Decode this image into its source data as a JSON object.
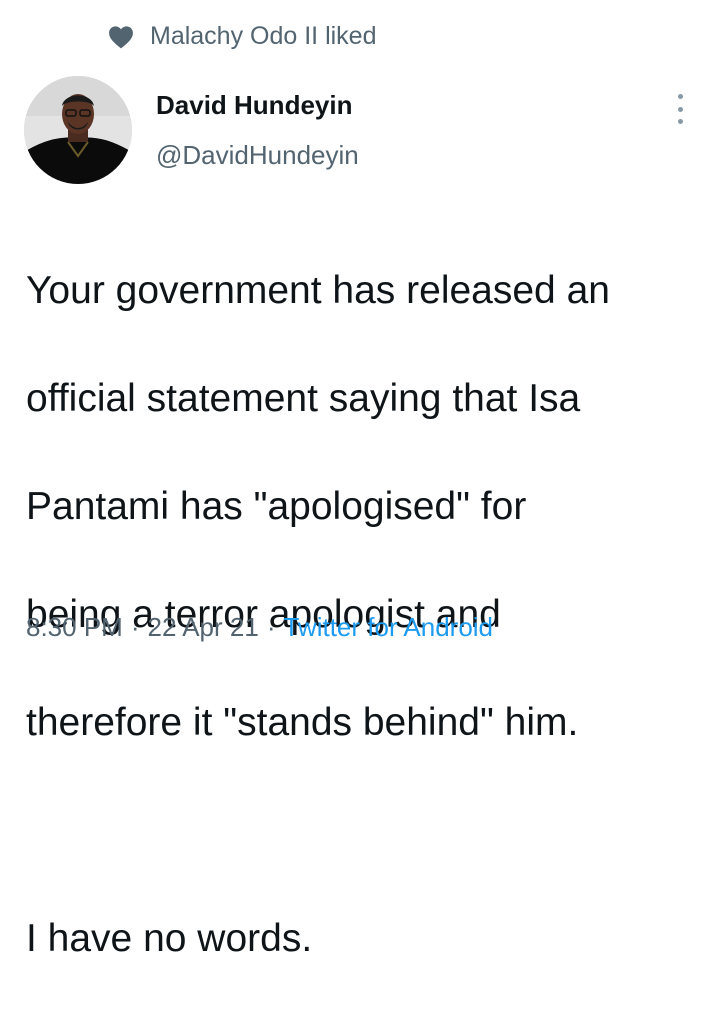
{
  "social_context": {
    "text": "Malachy Odo II liked",
    "icon": "heart-icon"
  },
  "author": {
    "name": "David Hundeyin",
    "handle": "@DavidHundeyin"
  },
  "tweet": {
    "lines": [
      "Your government has released an",
      "official statement saying that Isa",
      "Pantami has \"apologised\" for",
      "being a terror apologist and",
      "therefore it \"stands behind\" him."
    ],
    "closing": "I have no words."
  },
  "meta": {
    "time": "8:30 PM",
    "separator": "·",
    "date": "22 Apr 21",
    "source": "Twitter for Android"
  },
  "colors": {
    "text": "#0f1419",
    "secondary": "#536471",
    "link": "#1d9bf0",
    "more_dots": "#8899a6"
  }
}
